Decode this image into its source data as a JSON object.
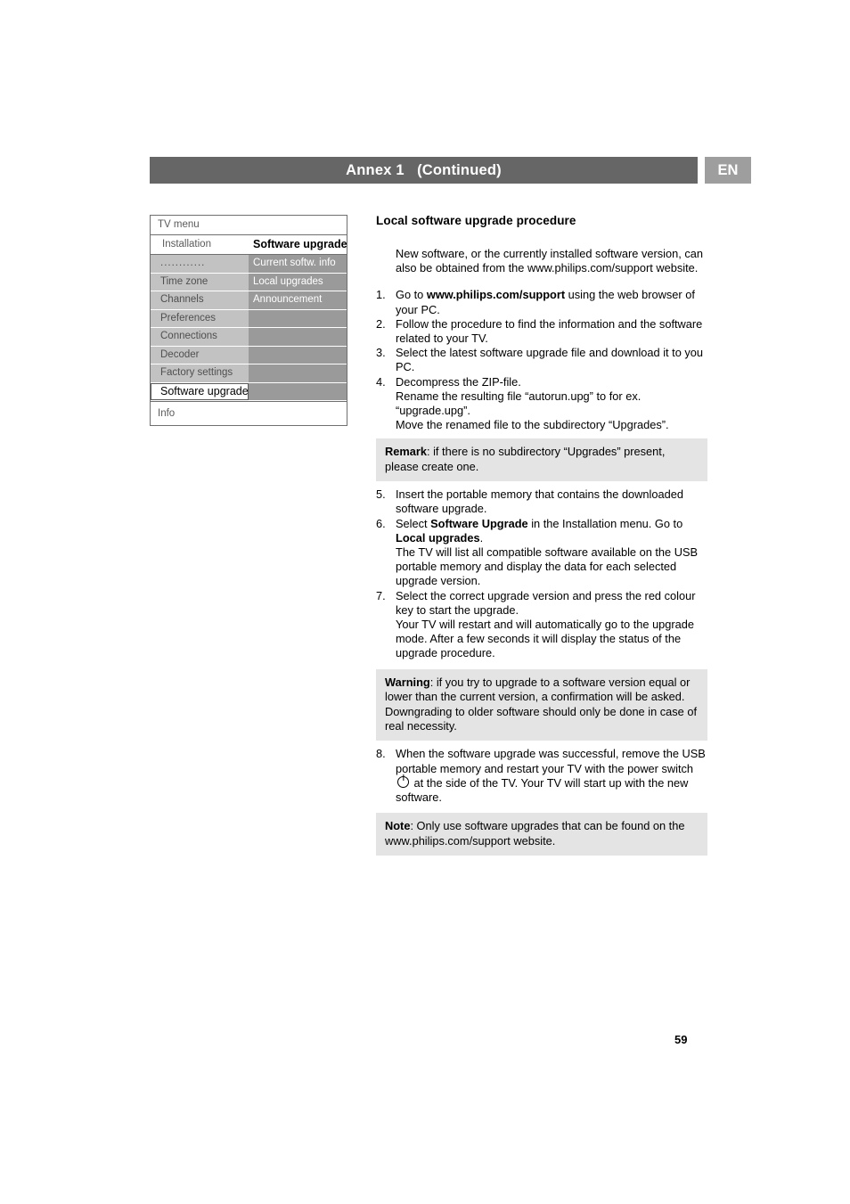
{
  "header": {
    "title": "Annex 1   (Continued)",
    "lang_badge": "EN",
    "bar_color": "#666666",
    "badge_color": "#9e9e9e"
  },
  "tv_menu": {
    "title": "TV menu",
    "info_label": "Info",
    "rows": [
      {
        "left": "Installation",
        "right": "Software upgrade",
        "style": "head"
      },
      {
        "left": "............",
        "right": "Current softw. info",
        "style": "normal"
      },
      {
        "left": "Time zone",
        "right": "Local upgrades",
        "style": "normal"
      },
      {
        "left": "Channels",
        "right": "Announcement",
        "style": "normal"
      },
      {
        "left": "Preferences",
        "right": "",
        "style": "normal"
      },
      {
        "left": "Connections",
        "right": "",
        "style": "normal"
      },
      {
        "left": "Decoder",
        "right": "",
        "style": "normal"
      },
      {
        "left": "Factory settings",
        "right": "",
        "style": "normal"
      },
      {
        "left": "Software upgrade",
        "right": "",
        "style": "selected"
      }
    ],
    "colors": {
      "left_cell": "#c2c2c2",
      "right_cell": "#9a9a9a",
      "selected_bg": "#ffffff",
      "border": "#6f6f6f"
    }
  },
  "content": {
    "title": "Local software upgrade procedure",
    "intro": "New software, or the currently installed software version, can also be obtained from the www.philips.com/support website.",
    "steps": [
      {
        "num": "1.",
        "parts": [
          {
            "t": "Go to ",
            "b": false
          },
          {
            "t": "www.philips.com/support",
            "b": true
          },
          {
            "t": " using the web browser of your PC.",
            "b": false
          }
        ]
      },
      {
        "num": "2.",
        "parts": [
          {
            "t": "Follow the procedure to find the information and the software related to your TV.",
            "b": false
          }
        ]
      },
      {
        "num": "3.",
        "parts": [
          {
            "t": "Select the latest software upgrade file and download it to you PC.",
            "b": false
          }
        ]
      },
      {
        "num": "4.",
        "parts": [
          {
            "t": "Decompress the ZIP-file.\nRename the resulting file “autorun.upg” to for ex. “upgrade.upg”.\nMove the renamed file to the subdirectory “Upgrades”.",
            "b": false
          }
        ]
      },
      {
        "num": "5.",
        "parts": [
          {
            "t": "Insert the portable memory that contains the downloaded software upgrade.",
            "b": false
          }
        ]
      },
      {
        "num": "6.",
        "parts": [
          {
            "t": "Select ",
            "b": false
          },
          {
            "t": "Software Upgrade",
            "b": true
          },
          {
            "t": " in the Installation menu. Go to ",
            "b": false
          },
          {
            "t": "Local upgrades",
            "b": true
          },
          {
            "t": ".\nThe TV will list all compatible software available on the USB portable memory and display the data for each selected upgrade version.",
            "b": false
          }
        ]
      },
      {
        "num": "7.",
        "parts": [
          {
            "t": "Select the correct upgrade version and press the red colour key to start the upgrade.\nYour TV will restart and will automatically go to the upgrade mode. After a few seconds it will display the status of the upgrade procedure.",
            "b": false
          }
        ]
      },
      {
        "num": "8.",
        "parts": [
          {
            "t": "When the software upgrade was successful, remove the USB portable memory and restart your TV with the power switch ",
            "b": false
          },
          {
            "t": "⏻",
            "b": false,
            "icon": "power-switch-icon"
          },
          {
            "t": " at the side of the TV. Your TV will start up with the new software.",
            "b": false
          }
        ]
      }
    ],
    "remark_box": {
      "label": "Remark",
      "text": ": if there is no subdirectory “Upgrades” present, please create one."
    },
    "warning_box": {
      "label": "Warning",
      "text": ": if you try to upgrade to a software version equal or lower than the current version, a confirmation will be asked. Downgrading to older software should only be done in case of real necessity."
    },
    "note_box": {
      "label": "Note",
      "text": ": Only use software upgrades that can be found on the www.philips.com/support website."
    }
  },
  "footer": {
    "page_number": "59"
  }
}
